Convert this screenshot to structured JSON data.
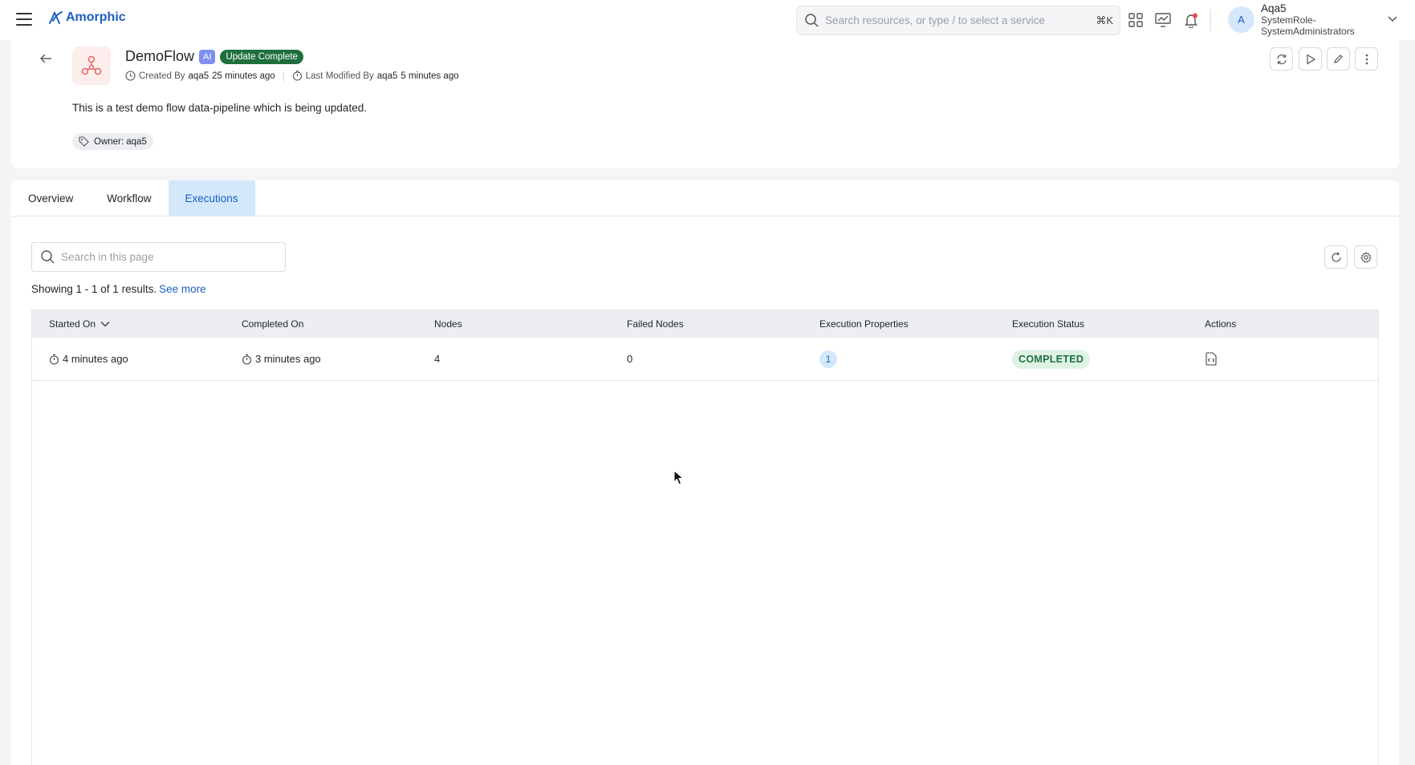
{
  "topbar": {
    "brand": "Amorphic",
    "search_placeholder": "Search resources, or type / to select a service",
    "search_shortcut": "⌘K",
    "user": {
      "initial": "A",
      "name": "Aqa5",
      "role_line1": "SystemRole-",
      "role_line2": "SystemAdministrators"
    }
  },
  "resource": {
    "name": "DemoFlow",
    "ai_badge": "AI",
    "status": "Update Complete",
    "created_prefix": "Created By",
    "created_by": "aqa5",
    "created_ago": "25 minutes ago",
    "modified_prefix": "Last Modified By",
    "modified_by": "aqa5",
    "modified_ago": "5 minutes ago",
    "description": "This is a test demo flow data-pipeline which is being updated.",
    "tag": "Owner: aqa5"
  },
  "tabs": [
    {
      "label": "Overview"
    },
    {
      "label": "Workflow"
    },
    {
      "label": "Executions"
    }
  ],
  "executions": {
    "search_placeholder": "Search in this page",
    "results_text": "Showing 1 - 1 of 1 results.",
    "see_more": "See more",
    "columns": [
      "Started On",
      "Completed On",
      "Nodes",
      "Failed Nodes",
      "Execution Properties",
      "Execution Status",
      "Actions"
    ],
    "rows": [
      {
        "started_on": "4 minutes ago",
        "completed_on": "3 minutes ago",
        "nodes": "4",
        "failed_nodes": "0",
        "properties": "1",
        "status": "COMPLETED"
      }
    ]
  },
  "colors": {
    "accent": "#1b5fbf",
    "success": "#1f6f3e",
    "active_tab": "#d3e8fb"
  }
}
